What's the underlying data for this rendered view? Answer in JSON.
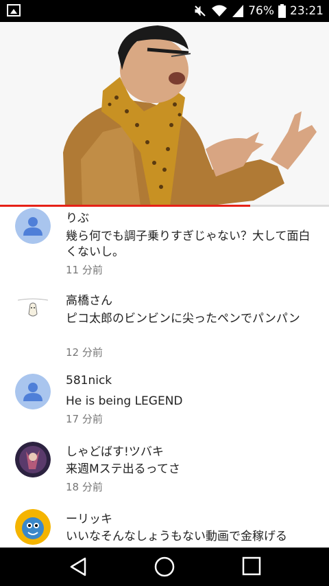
{
  "status_bar": {
    "battery_percent": "76%",
    "time": "23:21",
    "icons": [
      "gallery-icon",
      "mute-icon",
      "wifi-icon",
      "signal-icon",
      "battery-icon"
    ]
  },
  "video": {
    "progress_fraction": 0.76,
    "progress_color": "#e62117"
  },
  "comments": [
    {
      "author": "りぶ",
      "text": "幾ら何でも調子乗りすぎじゃない？大して面白くないし。",
      "time": "11 分前",
      "avatar": "default-avatar"
    },
    {
      "author": "高橋さん",
      "text": "ピコ太郎のビンビンに尖ったペンでパンパン",
      "time": "12 分前",
      "avatar": "drawing-avatar"
    },
    {
      "author": "581nick",
      "text": "He is being LEGEND",
      "time": "17 分前",
      "avatar": "default-avatar"
    },
    {
      "author": "しゃどばす!ツバキ",
      "text": "来週Mステ出るってさ",
      "time": "18 分前",
      "avatar": "anime-avatar"
    },
    {
      "author": "ーリッキ",
      "text": "いいなそんなしょうもない動画で金稼げる",
      "time": "",
      "avatar": "cartoon-avatar"
    }
  ],
  "nav_bar": {
    "buttons": [
      "back-button",
      "home-button",
      "recents-button"
    ]
  }
}
